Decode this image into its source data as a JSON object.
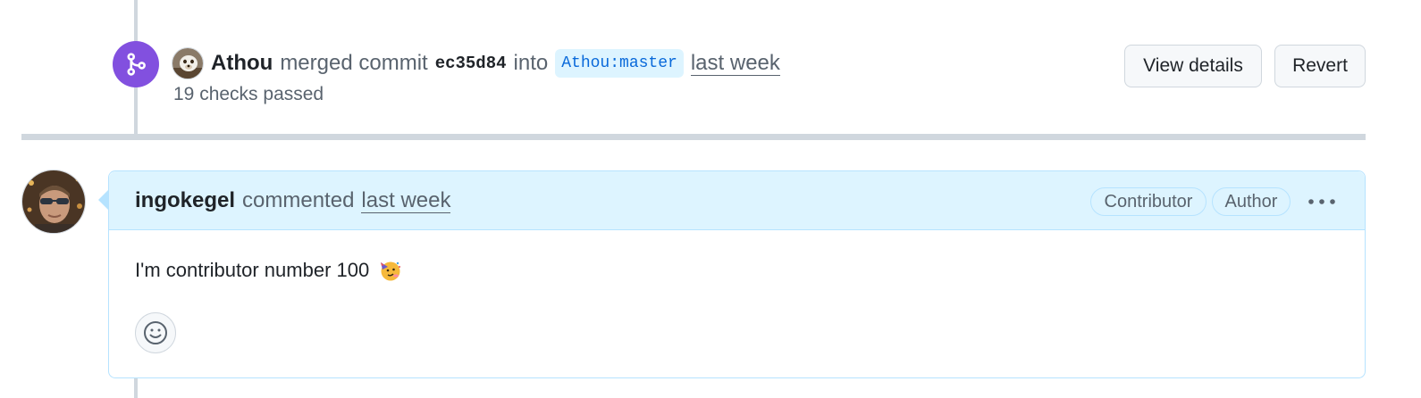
{
  "merge_event": {
    "icon": "git-merge-icon",
    "user": "Athou",
    "action": "merged commit",
    "commit_sha": "ec35d84",
    "into_text": "into",
    "branch": "Athou:master",
    "time": "last week",
    "checks": "19 checks passed",
    "buttons": {
      "view_details": "View details",
      "revert": "Revert"
    },
    "badge_color": "#8250df"
  },
  "comment": {
    "author": "ingokegel",
    "action": "commented",
    "time": "last week",
    "labels": [
      "Contributor",
      "Author"
    ],
    "menu_icon": "kebab-horizontal-icon",
    "body_text": "I'm contributor number 100",
    "body_emoji": "partying-face-icon",
    "reaction_icon": "smiley-icon",
    "header_bg": "#ddf4ff",
    "border_color": "#b6e3ff"
  }
}
